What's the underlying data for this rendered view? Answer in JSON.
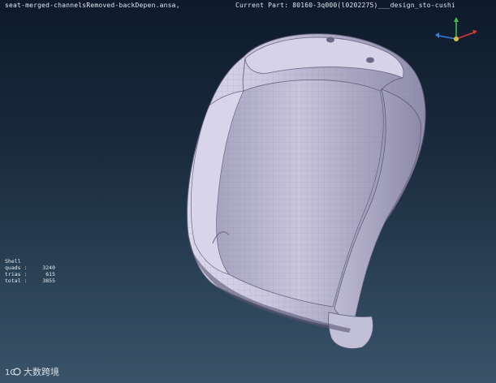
{
  "viewport": {
    "file_name": "seat-merged-channelsRemoved-backDepen.ansa,",
    "current_part": "Current Part: 80160-3q000(l0202275)___design_sto-cushi"
  },
  "stats": {
    "title": "Shell",
    "rows": [
      {
        "label": "quads :",
        "value": "3240"
      },
      {
        "label": "trias :",
        "value": "615"
      },
      {
        "label": "total :",
        "value": "3855"
      }
    ]
  },
  "watermark": {
    "logo_text": "1C",
    "text": "大数跨境"
  },
  "colors": {
    "background_top": "#0e1a2b",
    "background_bottom": "#3a5368",
    "mesh": "#c9c6dd",
    "axis_x": "#d43a3a",
    "axis_y": "#3fbf4a",
    "axis_z": "#3a7be0"
  }
}
